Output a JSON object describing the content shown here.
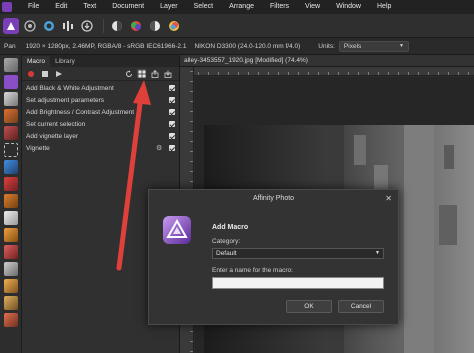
{
  "menubar": {
    "items": [
      "File",
      "Edit",
      "Text",
      "Document",
      "Layer",
      "Select",
      "Arrange",
      "Filters",
      "View",
      "Window",
      "Help"
    ]
  },
  "context": {
    "tool": "Pan",
    "image_info": "1920 × 1280px, 2.46MP, RGBA/8 - sRGB IEC61966-2.1",
    "camera_info": "NIKON D3300 (24.0-120.0 mm f/4.0)",
    "units_label": "Units:",
    "units_value": "Pixels"
  },
  "panel": {
    "tabs": [
      "Macro",
      "Library"
    ],
    "steps": [
      {
        "label": "Add Black & White Adjustment",
        "has_settings": false
      },
      {
        "label": "Set adjustment parameters",
        "has_settings": false
      },
      {
        "label": "Add Brightness / Contrast Adjustment",
        "has_settings": false
      },
      {
        "label": "Set current selection",
        "has_settings": false
      },
      {
        "label": "Add vignette layer",
        "has_settings": false
      },
      {
        "label": "Vignette",
        "has_settings": true
      }
    ]
  },
  "document": {
    "tab_title": "alley-3453557_1920.jpg [Modified] (74.4%)"
  },
  "dialog": {
    "window_title": "Affinity Photo",
    "heading": "Add Macro",
    "category_label": "Category:",
    "category_value": "Default",
    "name_label": "Enter a name for the macro:",
    "name_value": "",
    "ok_label": "OK",
    "cancel_label": "Cancel"
  },
  "colors": {
    "accent": "#7a3fb7",
    "annotation_arrow": "#e0403a"
  }
}
